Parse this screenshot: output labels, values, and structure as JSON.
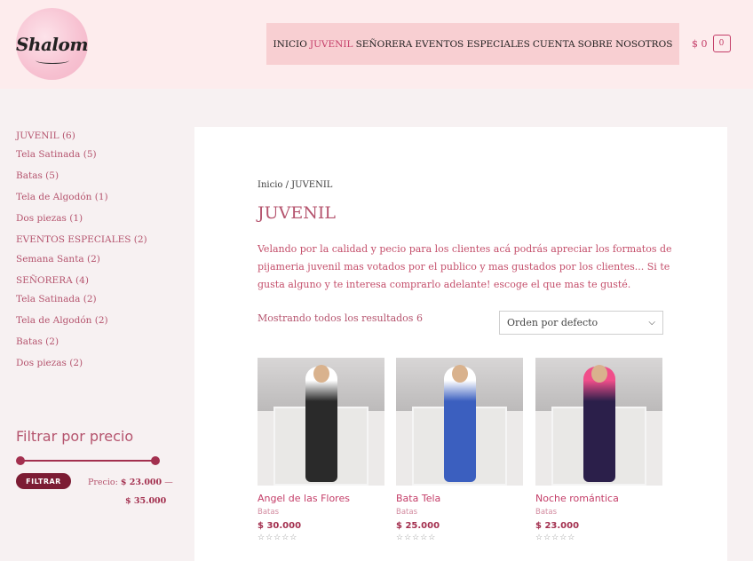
{
  "brand": {
    "logo_text": "Shalom"
  },
  "nav": {
    "items": [
      {
        "label": "INICIO"
      },
      {
        "label": "JUVENIL"
      },
      {
        "label": "SEÑORERA"
      },
      {
        "label": "EVENTOS ESPECIALES"
      },
      {
        "label": "CUENTA"
      },
      {
        "label": "SOBRE NOSOTROS"
      }
    ],
    "active": "JUVENIL"
  },
  "cart": {
    "total": "$ 0",
    "count": "0"
  },
  "sidebar": {
    "categories": [
      {
        "label": "JUVENIL (6)"
      },
      {
        "label": "Tela Satinada (5)"
      },
      {
        "label": "Batas (5)"
      },
      {
        "label": "Tela de Algodón (1)"
      },
      {
        "label": "Dos piezas (1)"
      },
      {
        "label": "EVENTOS ESPECIALES (2)"
      },
      {
        "label": "Semana Santa (2)"
      },
      {
        "label": "SEÑORERA (4)"
      },
      {
        "label": "Tela Satinada (2)"
      },
      {
        "label": "Tela de Algodón (2)"
      },
      {
        "label": "Batas (2)"
      },
      {
        "label": "Dos piezas (2)"
      }
    ],
    "filter": {
      "title": "Filtrar por precio",
      "button": "FILTRAR",
      "price_prefix": "Precio:",
      "min": "$ 23.000",
      "separator": "—",
      "max": "$ 35.000"
    }
  },
  "main": {
    "breadcrumb": "Inicio / JUVENIL",
    "title": "JUVENIL",
    "description": "Velando por la calidad y pecio para los clientes acá podrás apreciar los formatos de pijameria juvenil mas votados por el publico y mas gustados por los clientes... Si te gusta alguno y te interesa comprarlo adelante! escoge el que mas te gusté.",
    "result_count": "Mostrando todos los resultados 6",
    "sort": {
      "selected": "Orden por defecto"
    }
  },
  "products": [
    {
      "name": "Angel de las Flores",
      "category": "Batas",
      "price": "$ 30.000",
      "rating": 0,
      "dress_color": "#2a2a2a",
      "accent": "#ffffff"
    },
    {
      "name": "Bata Tela",
      "category": "Batas",
      "price": "$ 25.000",
      "rating": 0,
      "dress_color": "#3b5fbf",
      "accent": "#ffffff"
    },
    {
      "name": "Noche romántica",
      "category": "Batas",
      "price": "$ 23.000",
      "rating": 0,
      "dress_color": "#2b1f4a",
      "accent": "#f04e8a"
    }
  ],
  "colors": {
    "accent": "#c43d68",
    "nav_bg": "#f8cfd2",
    "header_bg": "#fdeced",
    "button_bg": "#7c1c34"
  }
}
